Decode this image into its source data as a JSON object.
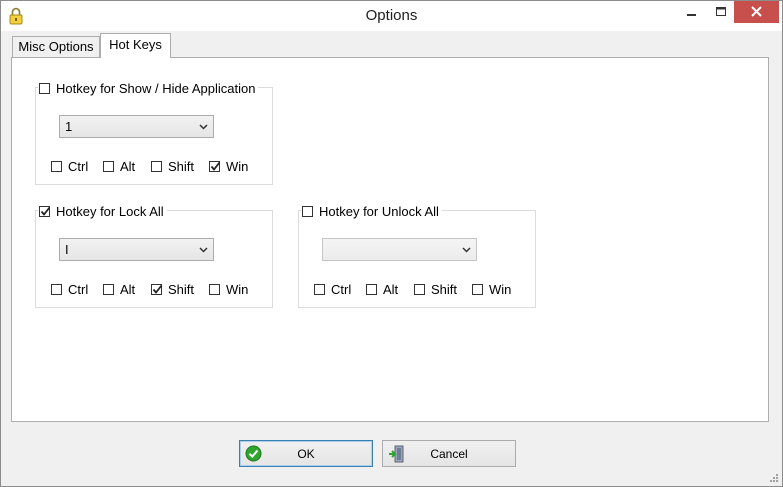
{
  "window": {
    "title": "Options"
  },
  "tabs": [
    {
      "label": "Misc Options",
      "active": false
    },
    {
      "label": "Hot Keys",
      "active": true
    }
  ],
  "groups": {
    "show_hide": {
      "title": "Hotkey for Show / Hide Application",
      "enabled": false,
      "key_value": "1",
      "modifiers": [
        {
          "label": "Ctrl",
          "checked": false
        },
        {
          "label": "Alt",
          "checked": false
        },
        {
          "label": "Shift",
          "checked": false
        },
        {
          "label": "Win",
          "checked": true
        }
      ]
    },
    "lock_all": {
      "title": "Hotkey for Lock All",
      "enabled": true,
      "key_value": "I",
      "modifiers": [
        {
          "label": "Ctrl",
          "checked": false
        },
        {
          "label": "Alt",
          "checked": false
        },
        {
          "label": "Shift",
          "checked": true
        },
        {
          "label": "Win",
          "checked": false
        }
      ]
    },
    "unlock_all": {
      "title": "Hotkey for Unlock All",
      "enabled": false,
      "key_value": "",
      "modifiers": [
        {
          "label": "Ctrl",
          "checked": false
        },
        {
          "label": "Alt",
          "checked": false
        },
        {
          "label": "Shift",
          "checked": false
        },
        {
          "label": "Win",
          "checked": false
        }
      ]
    }
  },
  "buttons": {
    "ok_label": "OK",
    "cancel_label": "Cancel"
  },
  "colors": {
    "close_button": "#c74f4c",
    "ok_icon": "#2fa52f",
    "default_button_border": "#3c7fb1"
  }
}
